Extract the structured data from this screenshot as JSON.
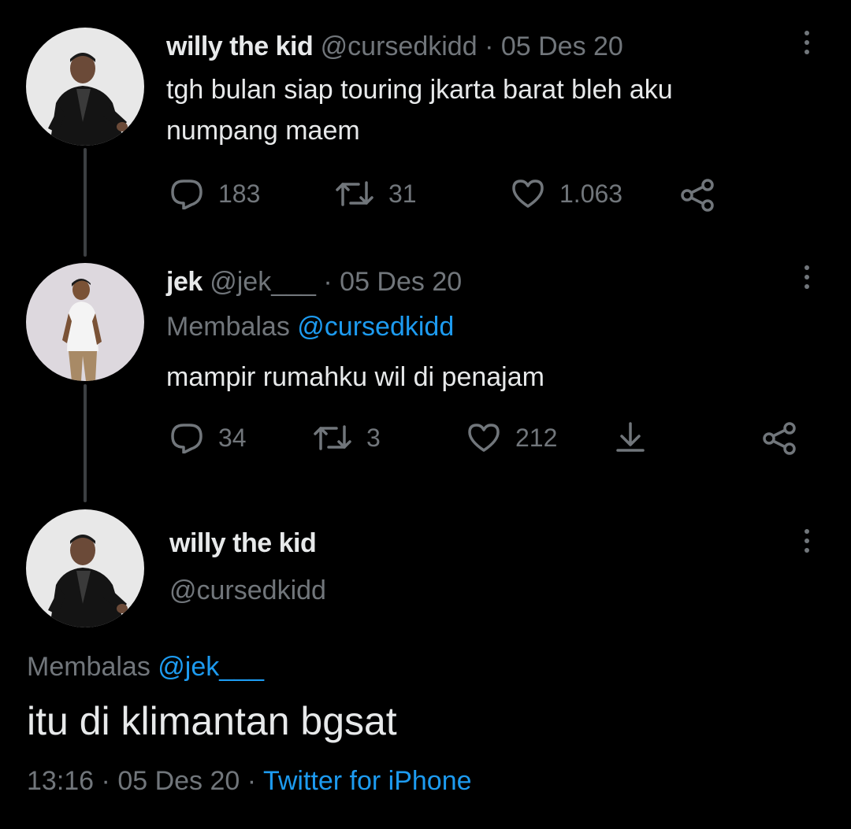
{
  "colors": {
    "background": "#000000",
    "text": "#e7e9ea",
    "muted": "#71767b",
    "link": "#1d9bf0",
    "thread_line": "#3c3f42"
  },
  "tweet1": {
    "avatar": "avatar-willy",
    "name": "willy the kid",
    "handle": "@cursedkidd",
    "separator": "·",
    "date": "05 Des 20",
    "text_line1": "tgh bulan siap touring jkarta barat bleh aku",
    "text_line2": "numpang maem",
    "reply_count": "183",
    "retweet_count": "31",
    "like_count": "1.063",
    "icons": [
      "reply-icon",
      "retweet-icon",
      "like-icon",
      "share-icon",
      "more-icon"
    ]
  },
  "tweet2": {
    "avatar": "avatar-jek",
    "name": "jek",
    "handle": "@jek___",
    "separator": "·",
    "date": "05 Des 20",
    "replying_label": "Membalas",
    "replying_to": "@cursedkidd",
    "text": "mampir rumahku wil di penajam",
    "reply_count": "34",
    "retweet_count": "3",
    "like_count": "212",
    "icons": [
      "reply-icon",
      "retweet-icon",
      "like-icon",
      "download-icon",
      "share-icon",
      "more-icon"
    ]
  },
  "main_tweet": {
    "avatar": "avatar-willy",
    "name": "willy the kid",
    "handle": "@cursedkidd",
    "replying_label": "Membalas",
    "replying_to": "@jek___",
    "text": "itu di klimantan bgsat",
    "time": "13:16",
    "separator": "·",
    "date": "05 Des 20",
    "source": "Twitter for iPhone",
    "icons": [
      "more-icon"
    ]
  }
}
